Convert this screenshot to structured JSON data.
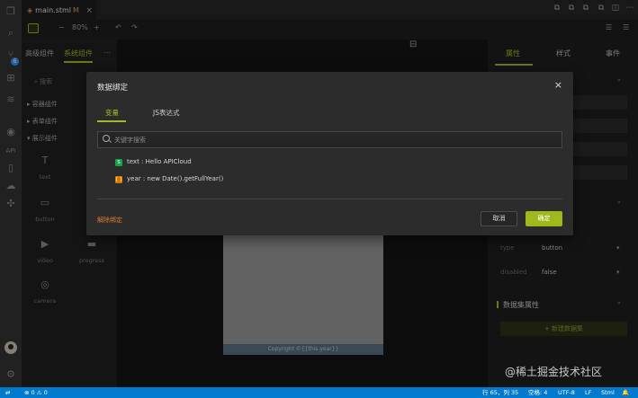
{
  "tab": {
    "filename": "main.stml",
    "modified_marker": "M"
  },
  "toolbar": {
    "zoom_minus": "−",
    "zoom": "80%",
    "zoom_plus": "+"
  },
  "left_panel": {
    "tabs": [
      "高级组件",
      "系统组件"
    ],
    "search_placeholder": "搜索",
    "groups": [
      "容器组件",
      "表单组件",
      "展示组件"
    ],
    "components": [
      {
        "label": "text",
        "icon": "T"
      },
      {
        "label": "button",
        "icon": "▭"
      },
      {
        "label": "video",
        "icon": "▶"
      },
      {
        "label": "progress",
        "icon": "▬"
      },
      {
        "label": "camera",
        "icon": "◎"
      }
    ]
  },
  "canvas": {
    "footer_text": "Copyright ©{{this.year}}"
  },
  "right_panel": {
    "tabs": [
      "属性",
      "样式",
      "事件"
    ],
    "rows": [
      {
        "label": "type",
        "value": "button"
      },
      {
        "label": "disabled",
        "value": "false"
      }
    ],
    "dataset_section": "数据集属性",
    "new_dataset_button": "+ 新建数据集"
  },
  "modal": {
    "title": "数据绑定",
    "tabs": [
      "变量",
      "JS表达式"
    ],
    "search_placeholder": "关键字搜索",
    "variables": [
      {
        "badge": "S",
        "color": "#16a34a",
        "text": "text : Hello APICloud"
      },
      {
        "badge": "[ ]",
        "color": "#d97706",
        "text": "year : new Date().getFullYear()"
      }
    ],
    "unbind": "解除绑定",
    "cancel": "取消",
    "confirm": "确定"
  },
  "statusbar": {
    "problems": "⊗ 0 ⚠ 0",
    "position": "行 65，列 35",
    "spaces": "空格: 4",
    "encoding": "UTF-8",
    "eol": "LF",
    "language": "Stml"
  },
  "watermark": "@稀土掘金技术社区",
  "activity": {
    "badge": "6",
    "api_label": "API"
  }
}
